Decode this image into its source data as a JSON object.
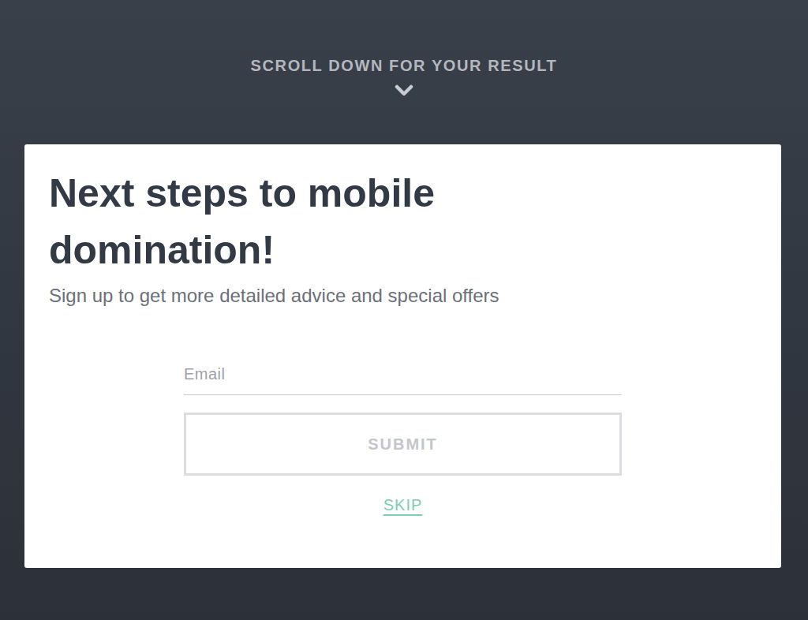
{
  "header": {
    "text": "SCROLL DOWN FOR YOUR RESULT"
  },
  "card": {
    "title": "Next steps to mobile domination!",
    "subtitle": "Sign up to get more detailed advice and special offers",
    "email": {
      "placeholder": "Email",
      "value": ""
    },
    "submit": {
      "label": "SUBMIT",
      "disabled": true
    },
    "skip": {
      "label": "SKIP"
    }
  }
}
